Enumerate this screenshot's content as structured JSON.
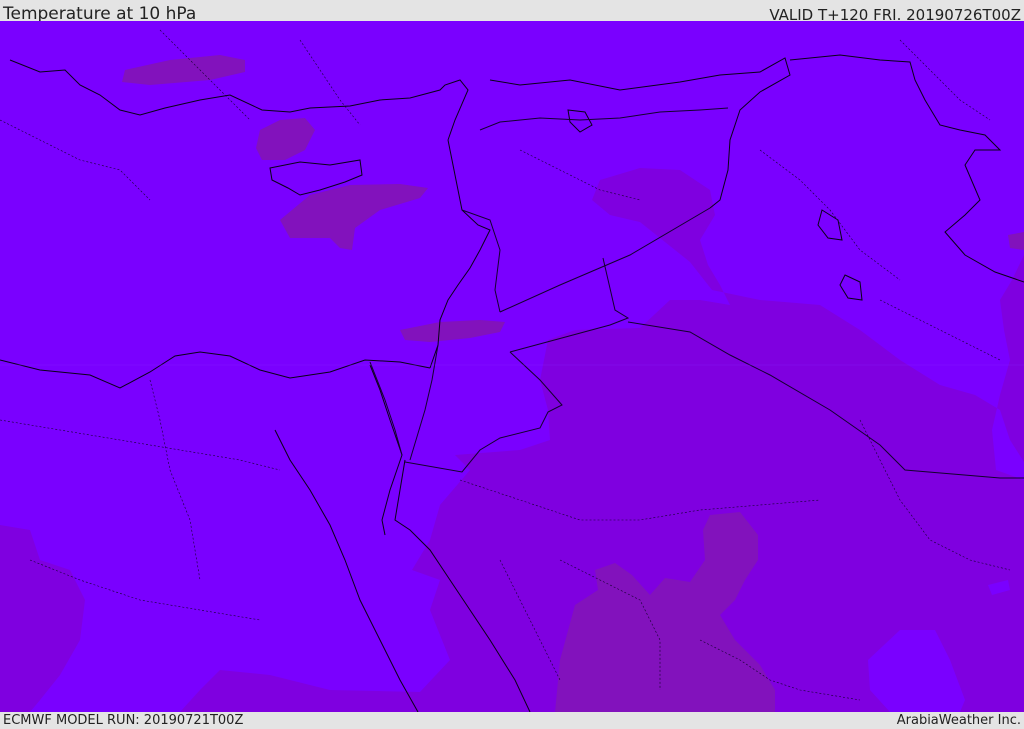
{
  "header": {
    "title": "Temperature at 10 hPa",
    "valid": "VALID T+120 FRI. 20190726T00Z"
  },
  "footer": {
    "model_run": "ECMWF MODEL RUN: 20190721T00Z",
    "credit": "ArabiaWeather Inc."
  },
  "colors": {
    "band_base": "#7a00ff",
    "band_mid": "#7f00e0",
    "band_dark": "#8212bc",
    "coastline": "#0a0018",
    "border": "#14002e"
  }
}
